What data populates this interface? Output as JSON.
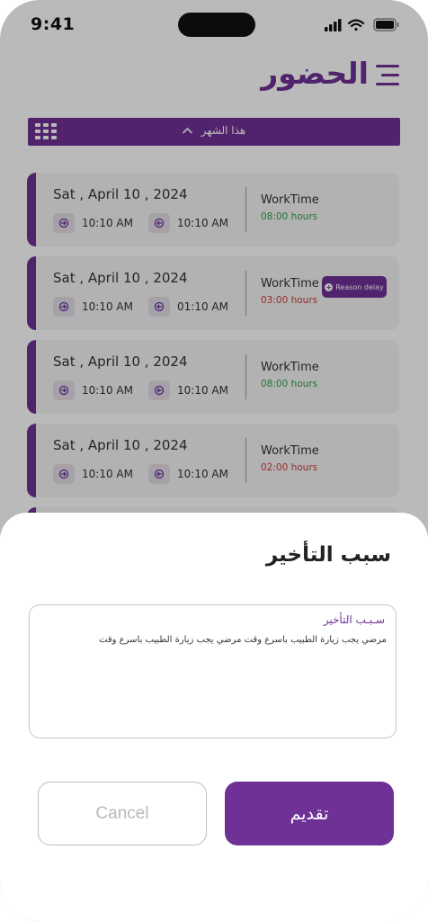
{
  "status_bar": {
    "time": "9:41",
    "icons": [
      "signal-icon",
      "wifi-icon",
      "battery-icon"
    ]
  },
  "header": {
    "title": "الحضور",
    "menu_icon": "menu-icon"
  },
  "filter": {
    "label": "هذا الشهر",
    "icon": "grid-icon"
  },
  "attendance": [
    {
      "date": "Sat , April 10 , 2024",
      "check_in": "10:10 AM",
      "check_out": "10:10 AM",
      "work_label": "WorkTime",
      "work_hours": "08:00 hours",
      "status": "ok"
    },
    {
      "date": "Sat , April 10 , 2024",
      "check_in": "10:10 AM",
      "check_out": "01:10 AM",
      "work_label": "WorkTime",
      "work_hours": "03:00 hours",
      "status": "short",
      "reason_label": "Reason delay"
    },
    {
      "date": "Sat , April 10 , 2024",
      "check_in": "10:10 AM",
      "check_out": "10:10 AM",
      "work_label": "WorkTime",
      "work_hours": "08:00 hours",
      "status": "ok"
    },
    {
      "date": "Sat , April 10 , 2024",
      "check_in": "10:10 AM",
      "check_out": "10:10 AM",
      "work_label": "WorkTime",
      "work_hours": "02:00 hours",
      "status": "short"
    }
  ],
  "sheet": {
    "title": "سبب التأخير",
    "field_label": "سـبـب التأخير",
    "field_value": "مرضي يجب زيارة الطبيب باسرع وقت مرضي يجب زيارة الطبيب باسرع وقت",
    "cancel_label": "Cancel",
    "submit_label": "تقديم"
  },
  "colors": {
    "accent": "#6f3196",
    "ok": "#2e9e4f",
    "short": "#d23b3b",
    "card": "#f5f5f5"
  }
}
